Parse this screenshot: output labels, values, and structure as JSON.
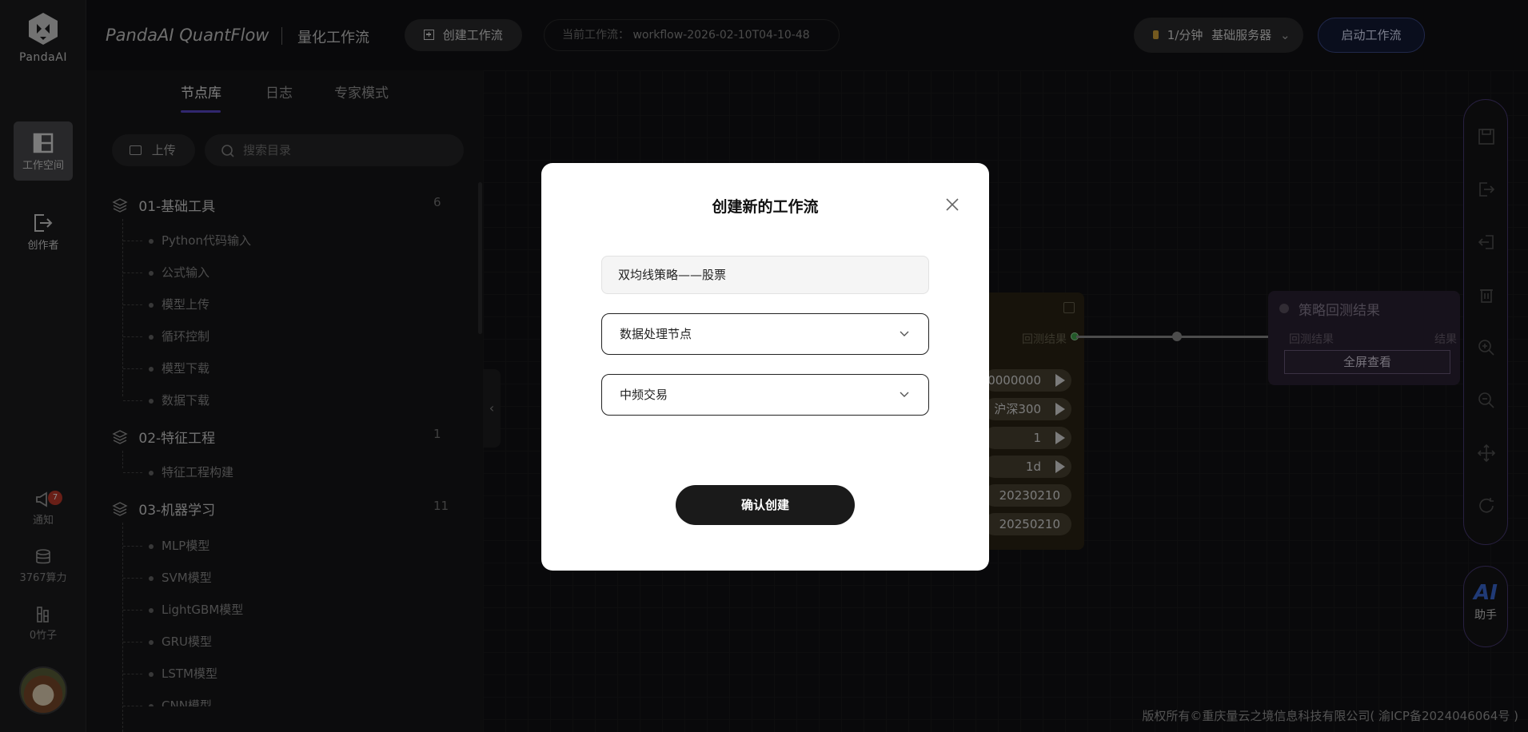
{
  "app": {
    "logo_text": "PandaAI",
    "brand": "PandaAI QuantFlow",
    "brand_sub": "量化工作流"
  },
  "rail": {
    "workspace_label": "工作空间",
    "creator_label": "创作者",
    "notify_label": "通知",
    "notify_badge": "7",
    "compute_label": "3767算力",
    "bamboo_label": "0竹子"
  },
  "topbar": {
    "create_workflow": "创建工作流",
    "current_flow_prefix": "当前工作流：",
    "current_flow_name": "workflow-2026-02-10T04-10-48",
    "server_rate": "1/分钟",
    "server_name": "基础服务器",
    "start_workflow": "启动工作流"
  },
  "panel": {
    "tabs": [
      "节点库",
      "日志",
      "专家模式"
    ],
    "upload": "上传",
    "search_placeholder": "搜索目录",
    "categories": [
      {
        "name": "01-基础工具",
        "count": "6",
        "items": [
          "Python代码输入",
          "公式输入",
          "模型上传",
          "循环控制",
          "模型下载",
          "数据下载"
        ]
      },
      {
        "name": "02-特征工程",
        "count": "1",
        "items": [
          "特征工程构建"
        ]
      },
      {
        "name": "03-机器学习",
        "count": "11",
        "items": [
          "MLP模型",
          "SVM模型",
          "LightGBM模型",
          "GRU模型",
          "LSTM模型",
          "CNN模型"
        ]
      }
    ]
  },
  "canvas": {
    "node_a": {
      "output_label": "回测结果",
      "rows": [
        "0000000",
        "沪深300",
        "1",
        "1d",
        "20230210",
        "20250210"
      ]
    },
    "node_b": {
      "title": "策略回测结果",
      "input_label": "回测结果",
      "output_label": "结果",
      "button": "全屏查看"
    }
  },
  "toolbar": {
    "ai_text": "AI",
    "ai_label": "助手"
  },
  "footer": "版权所有©重庆量云之境信息科技有限公司( 渝ICP备2024046064号 )",
  "modal": {
    "title": "创建新的工作流",
    "name_value": "双均线策略——股票",
    "node_type_value": "数据处理节点",
    "trade_type_value": "中频交易",
    "confirm": "确认创建"
  }
}
